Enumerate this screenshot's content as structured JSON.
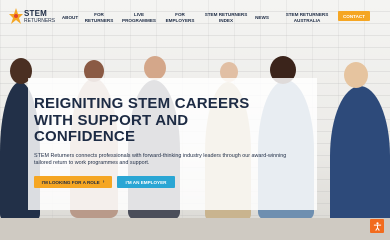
{
  "logo": {
    "line1": "STEM",
    "line2": "RETURNERS"
  },
  "nav": {
    "items": [
      {
        "label": "ABOUT"
      },
      {
        "label": "FOR RETURNERS"
      },
      {
        "label": "LIVE PROGRAMMES"
      },
      {
        "label": "FOR EMPLOYERS"
      },
      {
        "label": "STEM RETURNERS INDEX"
      },
      {
        "label": "NEWS"
      },
      {
        "label": "STEM RETURNERS AUSTRALIA"
      }
    ],
    "contact_label": "CONTACT"
  },
  "hero": {
    "title_lines": [
      "REIGNITING STEM CAREERS",
      "WITH SUPPORT AND",
      "CONFIDENCE"
    ],
    "description": "STEM Returners connects professionals with forward-thinking industry leaders through our award-winning tailored return to work programmes and support.",
    "primary_button": "I'M LOOKING FOR A ROLE",
    "secondary_button": "I'M AN EMPLOYER"
  },
  "colors": {
    "accent": "#f5a623",
    "secondary": "#2aa6d4",
    "navy": "#1d2b44",
    "accessibility": "#f26b1d"
  },
  "icons": {
    "primary_button_icon": "arrow-right-icon",
    "accessibility": "accessibility-icon"
  }
}
